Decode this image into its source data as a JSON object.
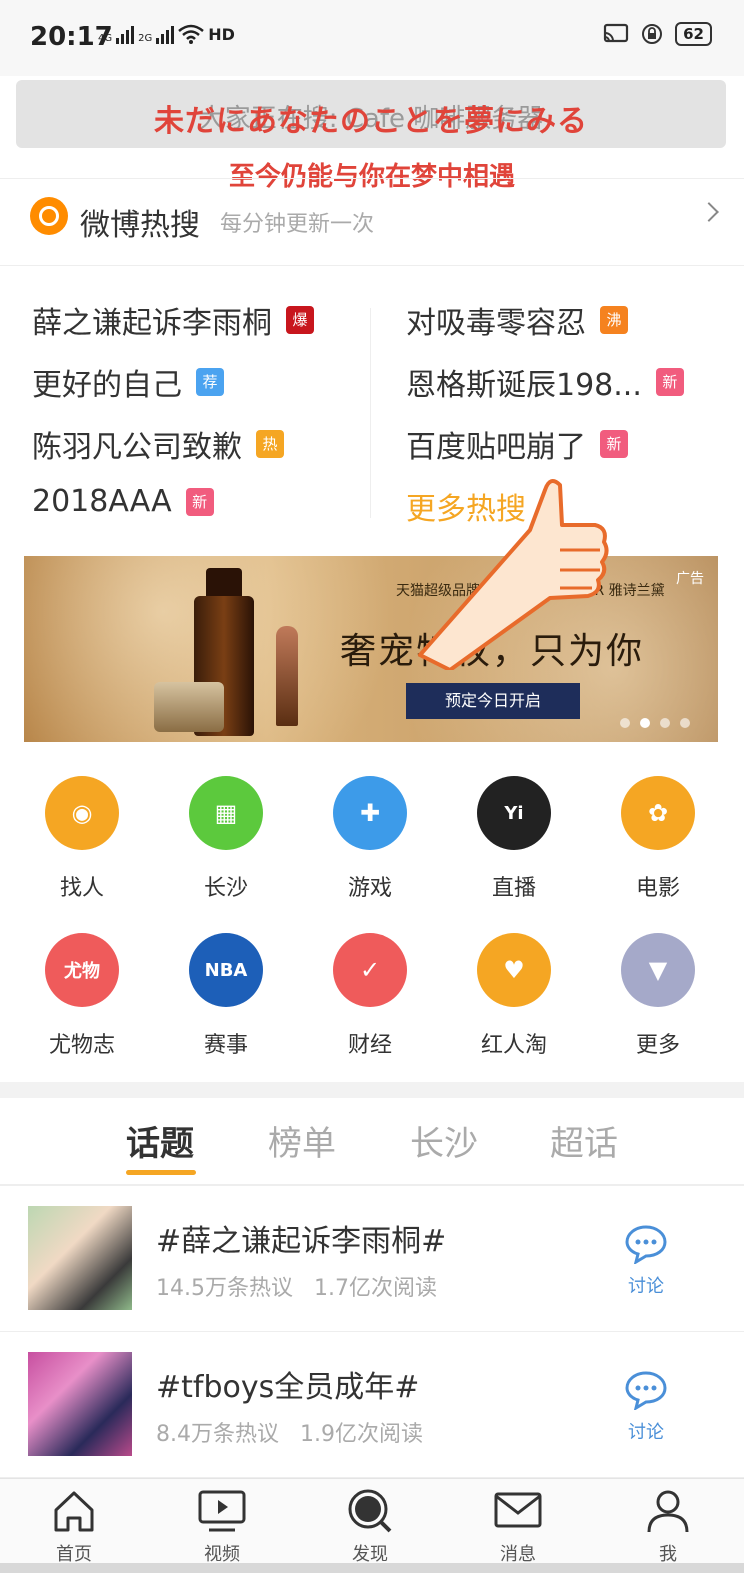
{
  "status_bar": {
    "time": "20:17",
    "signal1": "4G",
    "signal2": "2G",
    "network": "HD",
    "battery": "62"
  },
  "search": {
    "placeholder": "大家正在搜: Cafe 咖啡服务器"
  },
  "overlay": {
    "jp_text": "未だにあなたのことを夢にみる",
    "cn_text": "至今仍能与你在梦中相遇"
  },
  "hot_search": {
    "title": "微博热搜",
    "subtitle": "每分钟更新一次",
    "items_left": [
      {
        "text": "薛之谦起诉李雨桐",
        "tag": "爆",
        "tag_color": "#c8161d"
      },
      {
        "text": "更好的自己",
        "tag": "荐",
        "tag_color": "#4ba3f0"
      },
      {
        "text": "陈羽凡公司致歉",
        "tag": "热",
        "tag_color": "#f5a623"
      },
      {
        "text": "2018AAA",
        "tag": "新",
        "tag_color": "#f15c7e"
      }
    ],
    "items_right": [
      {
        "text": "对吸毒零容忍",
        "tag": "沸",
        "tag_color": "#f5821f"
      },
      {
        "text": "恩格斯诞辰198...",
        "tag": "新",
        "tag_color": "#f15c7e"
      },
      {
        "text": "百度贴吧崩了",
        "tag": "新",
        "tag_color": "#f15c7e"
      }
    ],
    "more": "更多热搜"
  },
  "ad": {
    "label": "广告",
    "brand": "天猫超级品牌日 ESTÉE LAUDER 雅诗兰黛",
    "headline": "奢宠特权，只为你",
    "cta": "预定今日开启"
  },
  "grid": [
    {
      "label": "找人",
      "color": "#f5a623",
      "icon": "find-person-icon",
      "glyph": "◉"
    },
    {
      "label": "长沙",
      "color": "#5cc93d",
      "icon": "city-icon",
      "glyph": "▦"
    },
    {
      "label": "游戏",
      "color": "#3d9be9",
      "icon": "gamepad-icon",
      "glyph": "✚"
    },
    {
      "label": "直播",
      "color": "#222222",
      "icon": "live-icon",
      "glyph": "Yi"
    },
    {
      "label": "电影",
      "color": "#f5a623",
      "icon": "film-reel-icon",
      "glyph": "✿"
    },
    {
      "label": "尤物志",
      "color": "#ef5b5b",
      "icon": "youwuzhi-icon",
      "glyph": "尤物"
    },
    {
      "label": "赛事",
      "color": "#1d5fb8",
      "icon": "nba-icon",
      "glyph": "NBA"
    },
    {
      "label": "财经",
      "color": "#ef5b5b",
      "icon": "finance-icon",
      "glyph": "✓"
    },
    {
      "label": "红人淘",
      "color": "#f5a623",
      "icon": "shopping-bag-icon",
      "glyph": "♥"
    },
    {
      "label": "更多",
      "color": "#a5a9c9",
      "icon": "more-icon",
      "glyph": "▼"
    }
  ],
  "tabs": [
    "话题",
    "榜单",
    "长沙",
    "超话"
  ],
  "topics": [
    {
      "title": "#薛之谦起诉李雨桐#",
      "discussions": "14.5万条热议",
      "reads": "1.7亿次阅读",
      "action": "讨论"
    },
    {
      "title": "#tfboys全员成年#",
      "discussions": "8.4万条热议",
      "reads": "1.9亿次阅读",
      "action": "讨论"
    }
  ],
  "bottom_nav": [
    "首页",
    "视频",
    "发现",
    "消息",
    "我"
  ]
}
